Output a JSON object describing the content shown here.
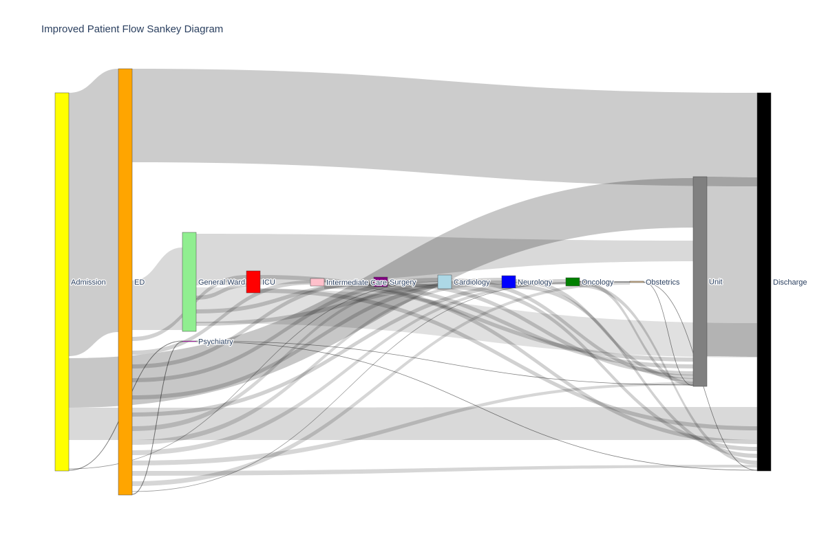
{
  "title": "Improved Patient Flow Sankey Diagram",
  "diagram": {
    "nodes": [
      {
        "id": "admission",
        "label": "Admission",
        "color": "#ffff00"
      },
      {
        "id": "ed",
        "label": "ED",
        "color": "#ffa500"
      },
      {
        "id": "general_ward",
        "label": "General Ward",
        "color": "#90ee90"
      },
      {
        "id": "icu",
        "label": "ICU",
        "color": "#ff0000"
      },
      {
        "id": "intermediate",
        "label": "Intermediate Care",
        "color": "#ffc0cb"
      },
      {
        "id": "surgery",
        "label": "Surgery",
        "color": "#800080"
      },
      {
        "id": "cardiology",
        "label": "Cardiology",
        "color": "#add8e6"
      },
      {
        "id": "neurology",
        "label": "Neurology",
        "color": "#0000ff"
      },
      {
        "id": "oncology",
        "label": "Oncology",
        "color": "#008000"
      },
      {
        "id": "obstetrics",
        "label": "Obstetrics",
        "color": "#d2b48c"
      },
      {
        "id": "psychiatry",
        "label": "Psychiatry",
        "color": "#ff00ff"
      },
      {
        "id": "unit",
        "label": "Unit",
        "color": "#808080"
      },
      {
        "id": "discharge",
        "label": "Discharge",
        "color": "#000000"
      }
    ],
    "link_color": "#000000"
  }
}
